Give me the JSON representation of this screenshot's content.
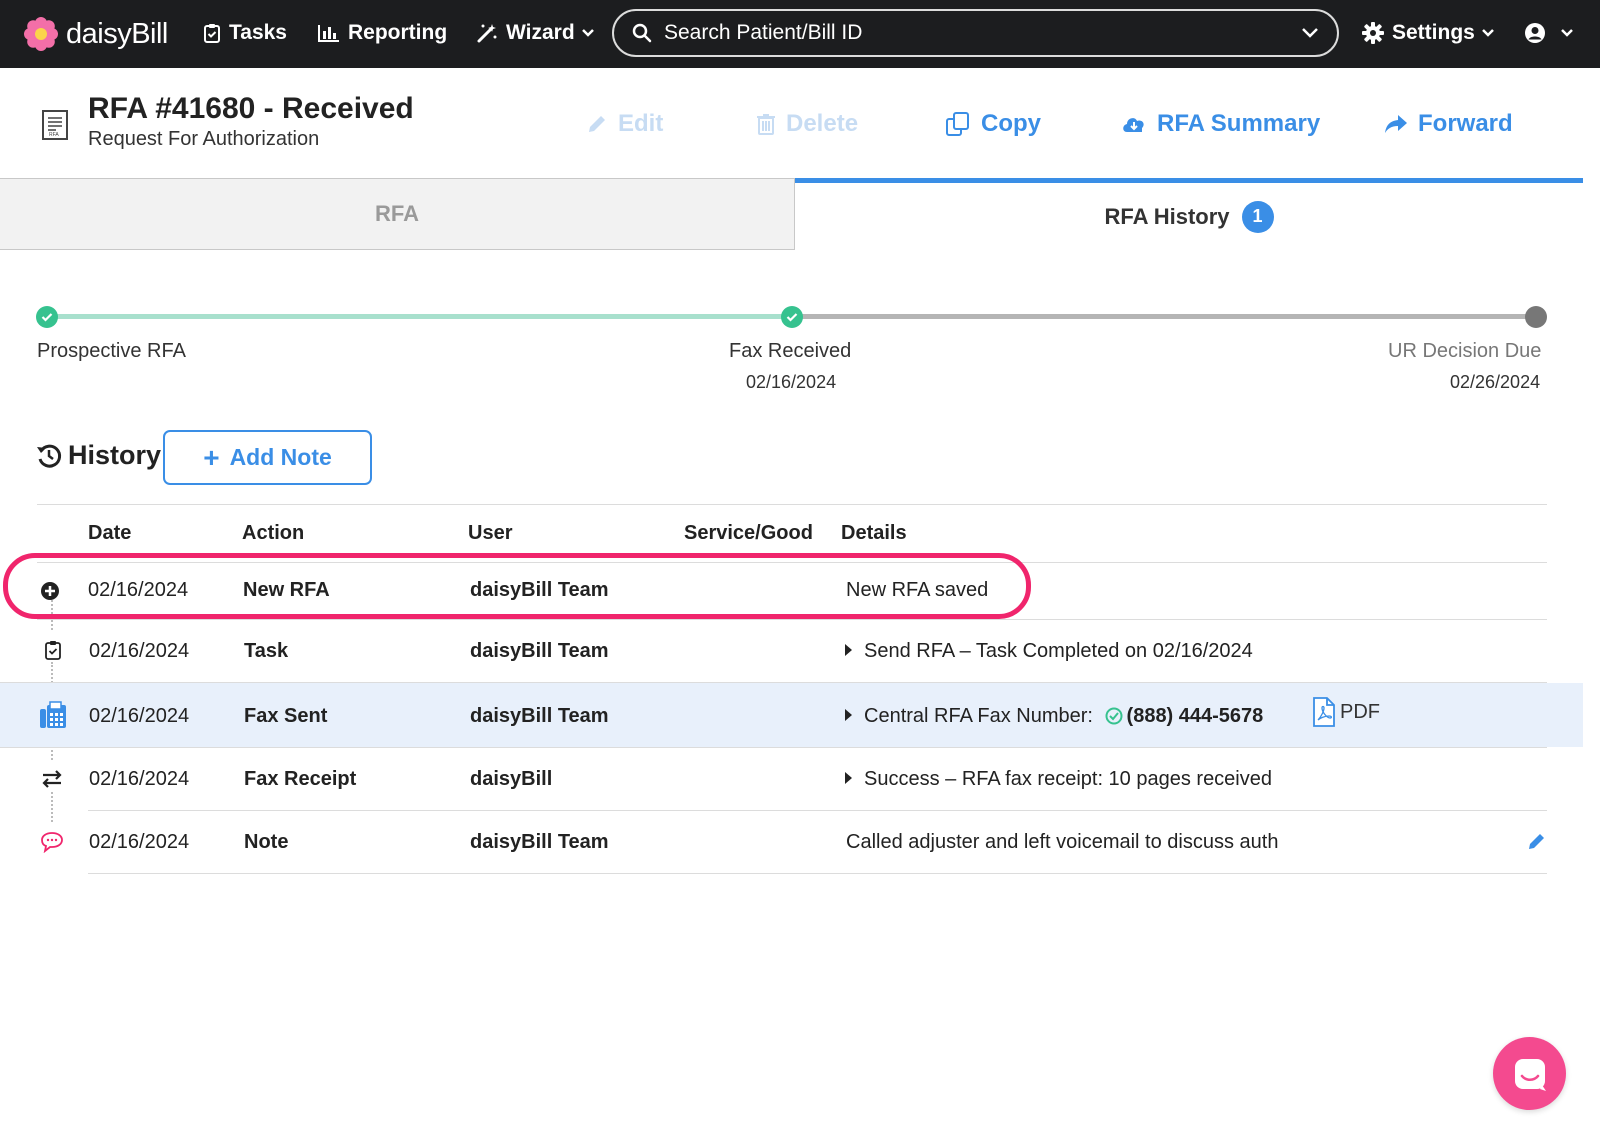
{
  "nav": {
    "brand": "daisyBill",
    "tasks": "Tasks",
    "reporting": "Reporting",
    "wizard": "Wizard",
    "search_placeholder": "Search Patient/Bill ID",
    "settings": "Settings"
  },
  "header": {
    "title": "RFA #41680 - Received",
    "subtitle": "Request For Authorization",
    "actions": {
      "edit": "Edit",
      "delete": "Delete",
      "copy": "Copy",
      "summary": "RFA Summary",
      "forward": "Forward"
    }
  },
  "tabs": {
    "rfa": "RFA",
    "history": "RFA History",
    "history_count": "1"
  },
  "timeline": [
    {
      "label": "Prospective RFA",
      "date": ""
    },
    {
      "label": "Fax Received",
      "date": "02/16/2024"
    },
    {
      "label": "UR Decision Due",
      "date": "02/26/2024"
    }
  ],
  "history": {
    "title": "History",
    "add_note": "Add Note",
    "columns": [
      "Date",
      "Action",
      "User",
      "Service/Good",
      "Details"
    ],
    "rows": [
      {
        "icon": "plus-circle-icon",
        "date": "02/16/2024",
        "action": "New RFA",
        "user": "daisyBill Team",
        "details": "New RFA saved"
      },
      {
        "icon": "clipboard-check-icon",
        "date": "02/16/2024",
        "action": "Task",
        "user": "daisyBill Team",
        "details": "Send RFA – Task Completed on 02/16/2024"
      },
      {
        "icon": "fax-icon",
        "date": "02/16/2024",
        "action": "Fax Sent",
        "user": "daisyBill Team",
        "details_label": "Central RFA Fax Number:",
        "details_number": "(888) 444-5678",
        "attachment": "PDF"
      },
      {
        "icon": "exchange-arrows-icon",
        "date": "02/16/2024",
        "action": "Fax Receipt",
        "user": "daisyBill",
        "details": "Success – RFA fax receipt: 10 pages received"
      },
      {
        "icon": "speech-bubble-icon",
        "date": "02/16/2024",
        "action": "Note",
        "user": "daisyBill Team",
        "details": "Called adjuster and left voicemail to discuss auth"
      }
    ]
  },
  "colors": {
    "accent": "#3a8ee6",
    "nav_bg": "#1c1d1f",
    "success": "#36c28f",
    "highlight_ring": "#f0256c",
    "chat": "#f44a8f"
  }
}
